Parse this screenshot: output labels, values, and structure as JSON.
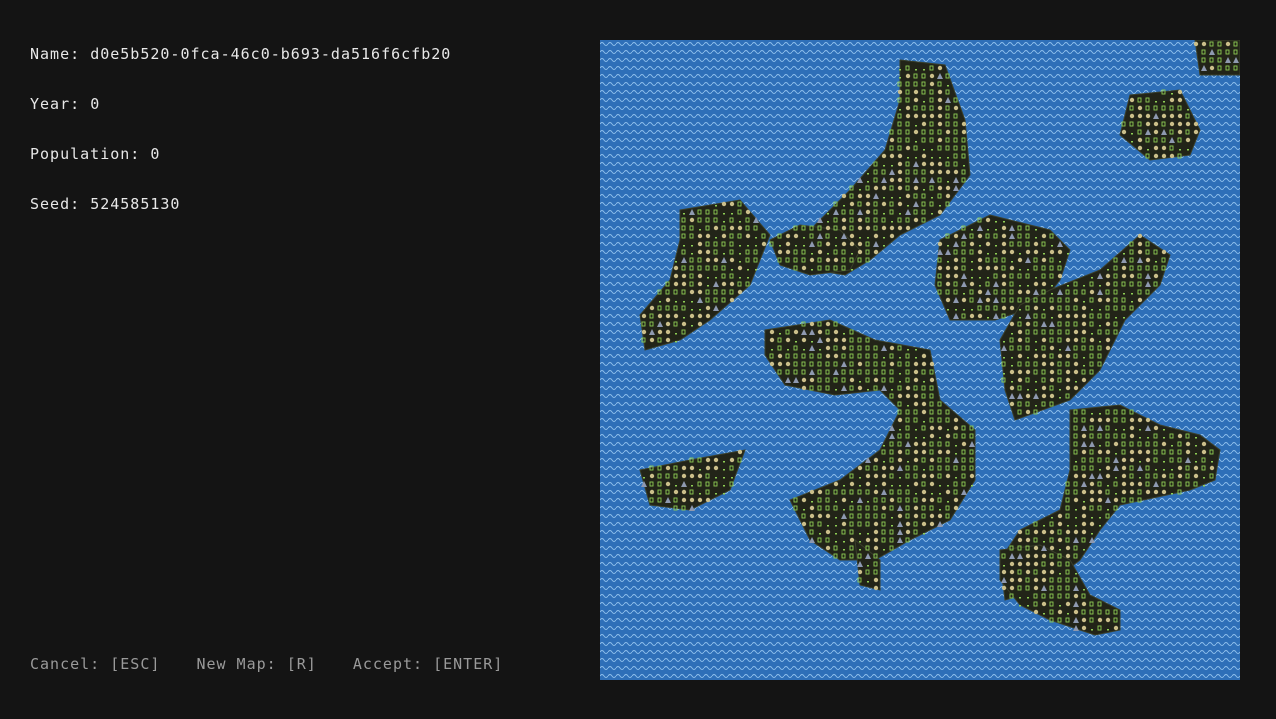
{
  "world": {
    "name_label": "Name:",
    "name_value": "d0e5b520-0fca-46c0-b693-da516f6cfb20",
    "year_label": "Year:",
    "year_value": "0",
    "population_label": "Population:",
    "population_value": "0",
    "seed_label": "Seed:",
    "seed_value": "524585130"
  },
  "controls": {
    "cancel": "Cancel: [ESC]",
    "new_map": "New Map: [R]",
    "accept": "Accept: [ENTER]"
  },
  "map": {
    "ocean_color": "#2e6fb8",
    "wave_color": "#8fc0ec",
    "land_color": "#222418",
    "grass_color": "#8fcf55",
    "tree_color": "#cbbf8a",
    "mountain_color": "#8e99b0",
    "terrain_types": [
      "ocean",
      "grassland",
      "forest",
      "mountain"
    ]
  }
}
